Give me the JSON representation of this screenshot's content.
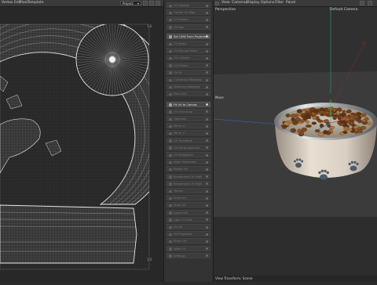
{
  "uv_editor": {
    "menu": [
      "Vertex Edit",
      "Pixel",
      "Template"
    ],
    "select_value": "Project",
    "axis_top": "1.0",
    "axis_bottom": "1.0"
  },
  "tool_panel": {
    "items": [
      {
        "label": "UV Unwrap",
        "active": false
      },
      {
        "label": "Frontal UV Map",
        "active": false
      },
      {
        "label": "UV Sphere",
        "active": false
      },
      {
        "label": "UV Box",
        "active": false
      },
      {
        "label": "Set UVW From Projection",
        "active": true
      },
      {
        "label": "UV Relax",
        "active": false
      },
      {
        "label": "UV Manual Relax",
        "active": false
      },
      {
        "label": "UV Cylinder",
        "active": false
      },
      {
        "label": "UV Flatten",
        "active": false
      },
      {
        "label": "UV Fit",
        "active": false
      },
      {
        "label": "Cylindrical Mapping",
        "active": false
      },
      {
        "label": "Spherical Mapping",
        "active": false
      },
      {
        "label": "Pack UVs",
        "active": false
      },
      {
        "label": "Fit UV to Canvas",
        "active": true
      },
      {
        "label": "UV Grid Snap",
        "active": false
      },
      {
        "label": "Optimize",
        "active": false
      },
      {
        "label": "Mirror U",
        "active": false
      },
      {
        "label": "Mirror V",
        "active": false
      },
      {
        "label": "UV Transform",
        "active": false
      },
      {
        "label": "UV Rectangularize",
        "active": false
      },
      {
        "label": "UV Straighten",
        "active": false
      },
      {
        "label": "Align Horizontal",
        "active": false
      },
      {
        "label": "Rotate UV",
        "active": false
      },
      {
        "label": "Randomize UV Shell",
        "active": false
      },
      {
        "label": "Randomize UV Shell",
        "active": false
      },
      {
        "label": "Terrain",
        "active": false
      },
      {
        "label": "Scale UV",
        "active": false
      },
      {
        "label": "Snap UV",
        "active": false
      },
      {
        "label": "Layout UV",
        "active": false
      },
      {
        "label": "Light UV Edit",
        "active": false
      },
      {
        "label": "Fix UV",
        "active": false
      },
      {
        "label": "UV Projection",
        "active": false
      },
      {
        "label": "Stitch UV",
        "active": false
      },
      {
        "label": "Weld UV",
        "active": false
      },
      {
        "label": "Settings",
        "active": false
      }
    ]
  },
  "viewport": {
    "menu": [
      "View",
      "Cameras",
      "Display",
      "Options",
      "Filter",
      "Panel"
    ],
    "label": "Perspective",
    "camera": "Default Camera",
    "move_label": "Move",
    "status": "View Transform: Scene"
  },
  "colors": {
    "axis_x": "#c83c3c",
    "axis_y": "#3cbf6a",
    "axis_z": "#3c6ad6"
  }
}
